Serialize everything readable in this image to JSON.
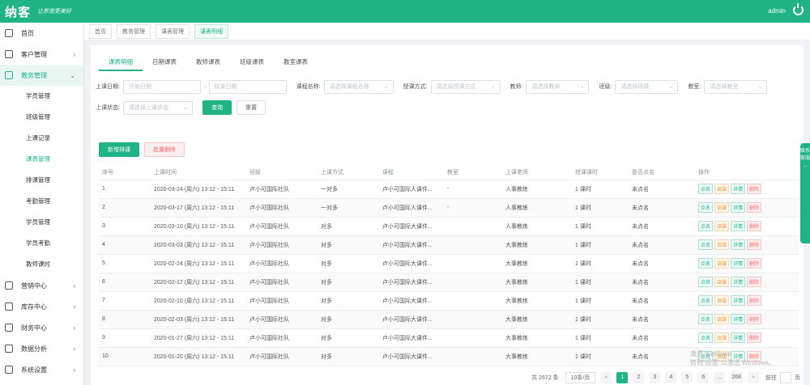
{
  "header": {
    "logo": "纳客",
    "slogan": "让养宠更美好",
    "user": "admin",
    "power_icon": "power-icon"
  },
  "sidebar": {
    "items": [
      {
        "label": "首页",
        "icon": "home-icon",
        "arrow": ""
      },
      {
        "label": "客户管理",
        "icon": "user-icon",
        "arrow": "›"
      },
      {
        "label": "教务管理",
        "icon": "book-icon",
        "arrow": "⌄"
      },
      {
        "label": "营销中心",
        "icon": "gift-icon",
        "arrow": "›"
      },
      {
        "label": "库存中心",
        "icon": "box-icon",
        "arrow": "›"
      },
      {
        "label": "财务中心",
        "icon": "wallet-icon",
        "arrow": "›"
      },
      {
        "label": "数据分析",
        "icon": "chart-icon",
        "arrow": "›"
      },
      {
        "label": "系统设置",
        "icon": "gear-icon",
        "arrow": "›"
      }
    ],
    "sub_items": [
      {
        "label": "学员管理"
      },
      {
        "label": "班级管理"
      },
      {
        "label": "上课记录"
      },
      {
        "label": "课表管理"
      },
      {
        "label": "排课管理"
      },
      {
        "label": "考勤管理"
      },
      {
        "label": "学员管理"
      },
      {
        "label": "学员考勤"
      },
      {
        "label": "教师课时"
      }
    ]
  },
  "breadcrumb": [
    "首页",
    "教务管理",
    "课表管理",
    "课表明细"
  ],
  "tabs": [
    "课表明细",
    "日期课表",
    "教师课表",
    "班级课表",
    "教室课表"
  ],
  "filters": {
    "date_label": "上课日期:",
    "start_placeholder": "开始日期",
    "end_placeholder": "结束日期",
    "sep": "-",
    "course_label": "课程名称:",
    "course_placeholder": "请选择课程名称",
    "teach_mode_label": "授课方式:",
    "teach_mode_placeholder": "请选择授课方式",
    "teacher_label": "教师:",
    "teacher_placeholder": "请选择教师",
    "class_label": "班级:",
    "class_placeholder": "请选择班级",
    "room_label": "教室:",
    "room_placeholder": "请选择教室",
    "status_label": "上课状态:",
    "status_placeholder": "请选择上课状态",
    "search": "查询",
    "reset": "重置"
  },
  "actions": {
    "add": "新增排课",
    "batch_delete": "批量删除"
  },
  "table": {
    "headers": [
      "序号",
      "",
      "上课时间",
      "班级",
      "上课方式",
      "课程",
      "教室",
      "上课老师",
      "授课课时",
      "是否点名",
      "操作"
    ],
    "rows": [
      {
        "no": "1",
        "time": "2020-03-24 (周六) 13:12 - 15:11",
        "cls": "卢小可国际社队",
        "mode": "一对多",
        "course": "卢小可国际人课件...",
        "room": "-",
        "teacher": "人事教练",
        "hours": "1 课时",
        "roll": "未点名"
      },
      {
        "no": "2",
        "time": "2020-03-17 (周六) 13:12 - 15:11",
        "cls": "卢小可国际社队",
        "mode": "一对多",
        "course": "卢小可国际人课件...",
        "room": "-",
        "teacher": "人事教练",
        "hours": "1 课时",
        "roll": "未点名"
      },
      {
        "no": "3",
        "time": "2020-03-10 (周六) 13:12 - 15:11",
        "cls": "卢小可国际社队",
        "mode": "对多",
        "course": "卢小可国际大课件...",
        "room": "",
        "teacher": "人事教练",
        "hours": "1 课时",
        "roll": "未点名"
      },
      {
        "no": "4",
        "time": "2020-03-03 (周六) 13:12 - 15:11",
        "cls": "卢小可国际社队",
        "mode": "对多",
        "course": "卢小可国际大课件...",
        "room": "",
        "teacher": "大事教练",
        "hours": "1 课时",
        "roll": "未点名"
      },
      {
        "no": "5",
        "time": "2020-02-24 (周六) 13:12 - 15:11",
        "cls": "卢小可国际社队",
        "mode": "对多",
        "course": "卢小可国际大课件...",
        "room": "",
        "teacher": "大事教练",
        "hours": "1 课时",
        "roll": "未点名"
      },
      {
        "no": "6",
        "time": "2020-02-17 (周六) 13:12 - 15:11",
        "cls": "卢小可国际社队",
        "mode": "对多",
        "course": "卢小可国际大课件...",
        "room": "",
        "teacher": "大事教练",
        "hours": "1 课时",
        "roll": "未点名"
      },
      {
        "no": "7",
        "time": "2020-02-10 (周六) 13:12 - 15:11",
        "cls": "卢小可国际社队",
        "mode": "对多",
        "course": "卢小可国际大课件...",
        "room": "",
        "teacher": "大事教练",
        "hours": "1 课时",
        "roll": "未点名"
      },
      {
        "no": "8",
        "time": "2020-02-03 (周六) 13:12 - 15:11",
        "cls": "卢小可国际社队",
        "mode": "对多",
        "course": "卢小可国际大课件...",
        "room": "",
        "teacher": "大事教练",
        "hours": "1 课时",
        "roll": "未点名"
      },
      {
        "no": "9",
        "time": "2020-01-27 (周六) 13:12 - 15:11",
        "cls": "卢小可国际社队",
        "mode": "对多",
        "course": "卢小可国际大课件...",
        "room": "",
        "teacher": "大事教练",
        "hours": "1 课时",
        "roll": "未点名"
      },
      {
        "no": "10",
        "time": "2020-01-20 (周六) 13:12 - 15:11",
        "cls": "卢小可国际社队",
        "mode": "对多",
        "course": "卢小可国际大课件...",
        "room": "",
        "teacher": "大事教练",
        "hours": "1 课时",
        "roll": "未点名"
      }
    ],
    "ops": [
      "点名",
      "调课",
      "详情",
      "删除"
    ]
  },
  "pager": {
    "total": "共 2672 条",
    "size": "10条/页",
    "prev": "‹",
    "pages": [
      "1",
      "2",
      "3",
      "4",
      "5",
      "6",
      "..."
    ],
    "last": "268",
    "next": "›",
    "goto": "前往",
    "page_unit": "页"
  },
  "side_float": "联系客服 ...",
  "watermark": {
    "line1": "激活 Windows",
    "line2": "转到\"设置\"以激活 Windows。"
  },
  "colors": {
    "brand": "#1fb386",
    "danger": "#f56c6c",
    "warning": "#e6a23c"
  }
}
